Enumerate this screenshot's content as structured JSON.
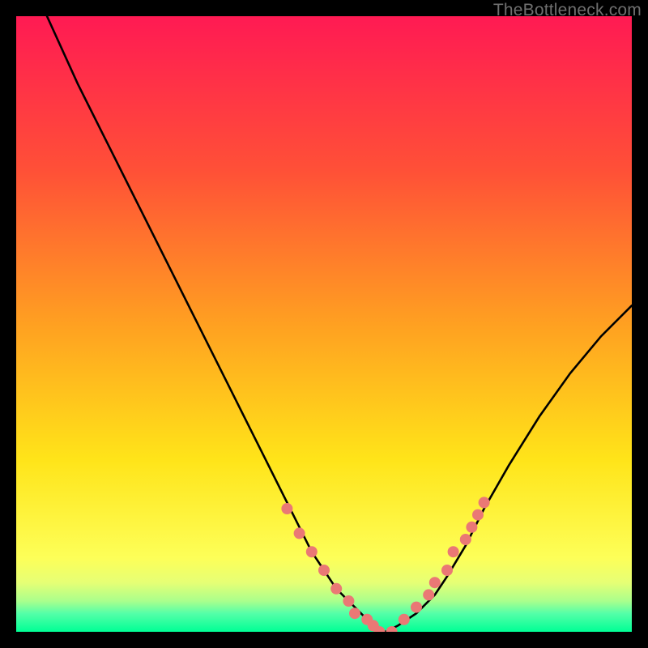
{
  "watermark": "TheBottleneck.com",
  "gradient_colors": {
    "0": "#ff1a53",
    "1": "#ff5037",
    "2": "#ffa021",
    "3": "#ffe419",
    "4": "#fdff58",
    "5": "#e6ff75",
    "6": "#aaff8c",
    "7": "#55ffa8",
    "8": "#00ff95"
  },
  "chart_data": {
    "type": "line",
    "title": "",
    "xlabel": "",
    "ylabel": "",
    "xlim": [
      0,
      100
    ],
    "ylim": [
      0,
      100
    ],
    "series": [
      {
        "name": "curve-left",
        "color": "#000000",
        "x": [
          5,
          10,
          15,
          20,
          25,
          30,
          35,
          40,
          45,
          48,
          50,
          52,
          54,
          56,
          58,
          60
        ],
        "values": [
          100,
          89,
          79,
          69,
          59,
          49,
          39,
          29,
          19,
          13,
          10,
          7,
          5,
          3,
          1,
          0
        ]
      },
      {
        "name": "curve-right",
        "color": "#000000",
        "x": [
          60,
          62,
          65,
          68,
          70,
          73,
          76,
          80,
          85,
          90,
          95,
          100
        ],
        "values": [
          0,
          1,
          3,
          6,
          9,
          14,
          20,
          27,
          35,
          42,
          48,
          53
        ]
      },
      {
        "name": "dots-left",
        "type": "scatter",
        "color": "#ea7875",
        "x": [
          44,
          46,
          48,
          50,
          52,
          54,
          55,
          57,
          58,
          59
        ],
        "values": [
          20,
          16,
          13,
          10,
          7,
          5,
          3,
          2,
          1,
          0
        ]
      },
      {
        "name": "dots-right",
        "type": "scatter",
        "color": "#ea7875",
        "x": [
          61,
          63,
          65,
          67,
          68,
          70,
          71,
          73,
          74,
          75,
          76
        ],
        "values": [
          0,
          2,
          4,
          6,
          8,
          10,
          13,
          15,
          17,
          19,
          21
        ]
      }
    ]
  }
}
